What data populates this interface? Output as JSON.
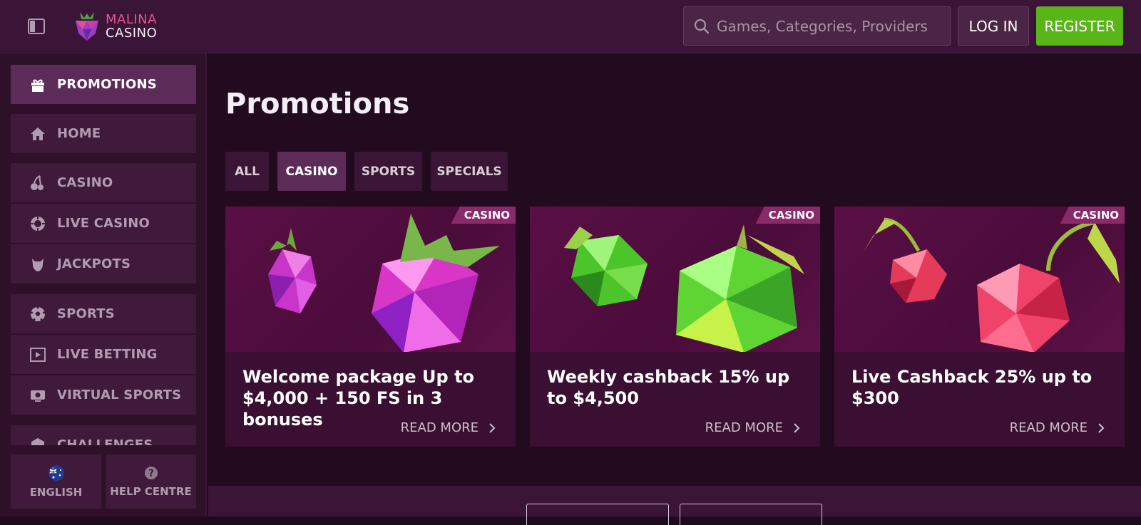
{
  "header": {
    "logo_line1": "MALINA",
    "logo_line2": "CASINO",
    "search_placeholder": "Games, Categories, Providers",
    "login_label": "LOG IN",
    "register_label": "REGISTER"
  },
  "sidebar": {
    "items": [
      {
        "label": "PROMOTIONS",
        "icon": "gift-icon"
      },
      {
        "label": "HOME",
        "icon": "home-icon"
      },
      {
        "label": "CASINO",
        "icon": "cherries-icon"
      },
      {
        "label": "LIVE CASINO",
        "icon": "chip-icon"
      },
      {
        "label": "JACKPOTS",
        "icon": "dragon-icon"
      },
      {
        "label": "SPORTS",
        "icon": "soccer-ball-icon"
      },
      {
        "label": "LIVE BETTING",
        "icon": "live-screen-icon"
      },
      {
        "label": "VIRTUAL SPORTS",
        "icon": "virtual-icon"
      },
      {
        "label": "CHALLENGES",
        "icon": "badge-icon"
      }
    ],
    "language_label": "ENGLISH",
    "help_label": "HELP CENTRE"
  },
  "main": {
    "title": "Promotions",
    "tabs": [
      "ALL",
      "CASINO",
      "SPORTS",
      "SPECIALS"
    ],
    "active_tab": "CASINO",
    "cards": [
      {
        "badge": "CASINO",
        "title": "Welcome package Up to $4,000 + 150 FS in 3 bonuses",
        "cta": "READ MORE",
        "image": "raspberries"
      },
      {
        "badge": "CASINO",
        "title": "Weekly cashback 15% up to $4,500",
        "cta": "READ MORE",
        "image": "green-apples"
      },
      {
        "badge": "CASINO",
        "title": "Live Cashback 25% up to $300",
        "cta": "READ MORE",
        "image": "cherries"
      }
    ]
  },
  "colors": {
    "accent": "#5c2b58",
    "register": "#5ab519",
    "badge": "#8b2a6b",
    "background": "#230b1f"
  }
}
